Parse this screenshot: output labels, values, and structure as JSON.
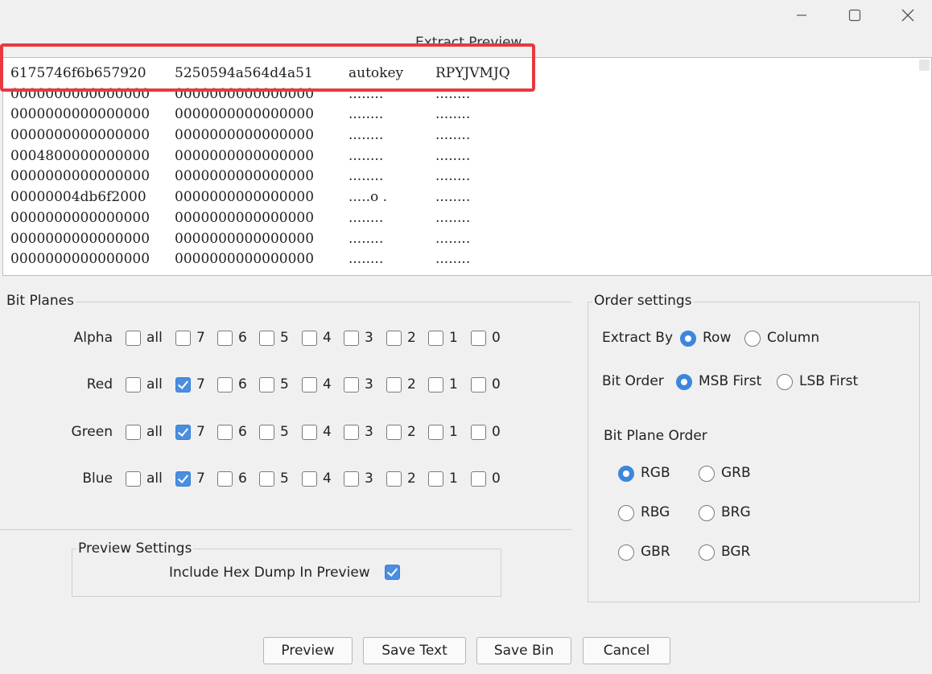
{
  "window": {
    "minimize_icon": "minimize-icon",
    "maximize_icon": "maximize-icon",
    "close_icon": "close-icon"
  },
  "preview": {
    "title": "Extract Preview",
    "rows": [
      [
        "6175746f6b657920",
        "5250594a564d4a51",
        "autokey ",
        "RPYJVMJQ"
      ],
      [
        "0000000000000000",
        "0000000000000000",
        "........",
        "........"
      ],
      [
        "0000000000000000",
        "0000000000000000",
        "........",
        "........"
      ],
      [
        "0000000000000000",
        "0000000000000000",
        "........",
        "........"
      ],
      [
        "0004800000000000",
        "0000000000000000",
        "........",
        "........"
      ],
      [
        "0000000000000000",
        "0000000000000000",
        "........",
        "........"
      ],
      [
        "00000004db6f2000",
        "0000000000000000",
        ".....o .",
        "........"
      ],
      [
        "0000000000000000",
        "0000000000000000",
        "........",
        "........"
      ],
      [
        "0000000000000000",
        "0000000000000000",
        "........",
        "........"
      ],
      [
        "0000000000000000",
        "0000000000000000",
        "........",
        "........"
      ]
    ],
    "highlight_color": "#e8393f"
  },
  "bit_planes": {
    "title": "Bit Planes",
    "columns": [
      "all",
      "7",
      "6",
      "5",
      "4",
      "3",
      "2",
      "1",
      "0"
    ],
    "planes": [
      {
        "name": "Alpha",
        "checked": []
      },
      {
        "name": "Red",
        "checked": [
          "7"
        ]
      },
      {
        "name": "Green",
        "checked": [
          "7"
        ]
      },
      {
        "name": "Blue",
        "checked": [
          "7"
        ]
      }
    ]
  },
  "preview_settings": {
    "title": "Preview Settings",
    "hex_dump_label": "Include Hex Dump In Preview",
    "hex_dump_checked": true
  },
  "order_settings": {
    "title": "Order settings",
    "extract_by_label": "Extract By",
    "extract_by_options": [
      "Row",
      "Column"
    ],
    "extract_by_selected": "Row",
    "bit_order_label": "Bit Order",
    "bit_order_options": [
      "MSB First",
      "LSB First"
    ],
    "bit_order_selected": "MSB First",
    "bit_plane_order_label": "Bit Plane Order",
    "bit_plane_order_options": [
      "RGB",
      "GRB",
      "RBG",
      "BRG",
      "GBR",
      "BGR"
    ],
    "bit_plane_order_selected": "RGB"
  },
  "buttons": {
    "preview": "Preview",
    "save_text": "Save Text",
    "save_bin": "Save Bin",
    "cancel": "Cancel"
  },
  "colors": {
    "accent": "#3e86dc",
    "background": "#f0f0f0"
  }
}
